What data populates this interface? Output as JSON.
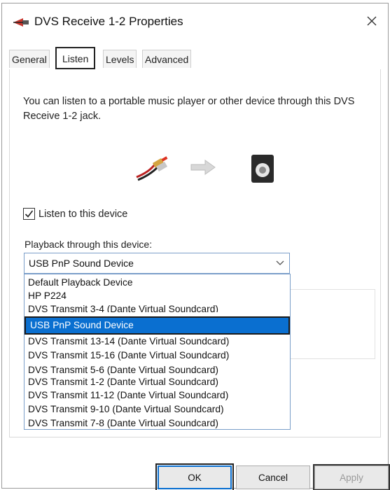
{
  "window": {
    "title": "DVS Receive  1-2 Properties"
  },
  "tabs": [
    {
      "label": "General"
    },
    {
      "label": "Listen"
    },
    {
      "label": "Levels"
    },
    {
      "label": "Advanced"
    }
  ],
  "listen": {
    "description": "You can listen to a portable music player or other device through this DVS Receive  1-2 jack.",
    "checkbox_label": "Listen to this device",
    "checkbox_checked": true,
    "playback_label": "Playback through this device:",
    "selected_device": "USB PnP Sound Device",
    "options": [
      "Default Playback Device",
      "HP P224",
      "DVS Transmit  3-4 (Dante Virtual Soundcard)",
      "USB PnP Sound Device",
      "DVS Transmit 13-14 (Dante Virtual Soundcard)",
      "DVS Transmit 15-16 (Dante Virtual Soundcard)",
      "DVS Transmit  5-6 (Dante Virtual Soundcard)",
      "DVS Transmit  1-2 (Dante Virtual Soundcard)",
      "DVS Transmit 11-12 (Dante Virtual Soundcard)",
      "DVS Transmit  9-10 (Dante Virtual Soundcard)",
      "DVS Transmit  7-8 (Dante Virtual Soundcard)"
    ]
  },
  "buttons": {
    "ok": "OK",
    "cancel": "Cancel",
    "apply": "Apply"
  },
  "icons": {
    "title": "audio-jack-icon",
    "close": "close-icon",
    "source": "rca-cable-icon",
    "arrow": "arrow-right-icon",
    "speaker": "speaker-icon",
    "combo_arrow": "chevron-down-icon"
  },
  "colors": {
    "selection": "#0a6fd0",
    "combo_border": "#7a9ec9"
  }
}
